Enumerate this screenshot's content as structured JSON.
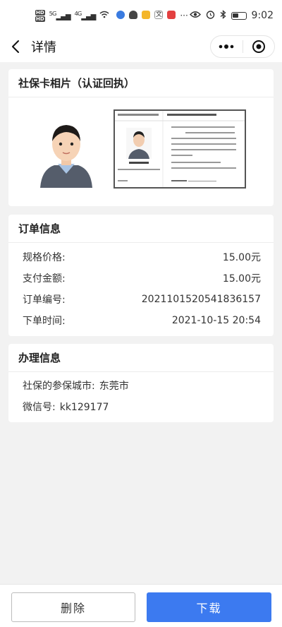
{
  "status": {
    "time": "9:02",
    "network1": "5G",
    "network2": "4G"
  },
  "nav": {
    "title": "详情"
  },
  "photo_card": {
    "title": "社保卡相片（认证回执）"
  },
  "order": {
    "title": "订单信息",
    "rows": [
      {
        "label": "规格价格:",
        "value": "15.00元"
      },
      {
        "label": "支付金额:",
        "value": "15.00元"
      },
      {
        "label": "订单编号:",
        "value": "2021101520541836157"
      },
      {
        "label": "下单时间:",
        "value": "2021-10-15 20:54"
      }
    ]
  },
  "handle": {
    "title": "办理信息",
    "rows": [
      {
        "label": "社保的参保城市:",
        "value": "东莞市"
      },
      {
        "label": "微信号:",
        "value": "kk129177"
      }
    ]
  },
  "actions": {
    "delete_label": "删除",
    "download_label": "下载"
  },
  "colors": {
    "primary": "#3c7af0",
    "background": "#f2f2f2"
  }
}
